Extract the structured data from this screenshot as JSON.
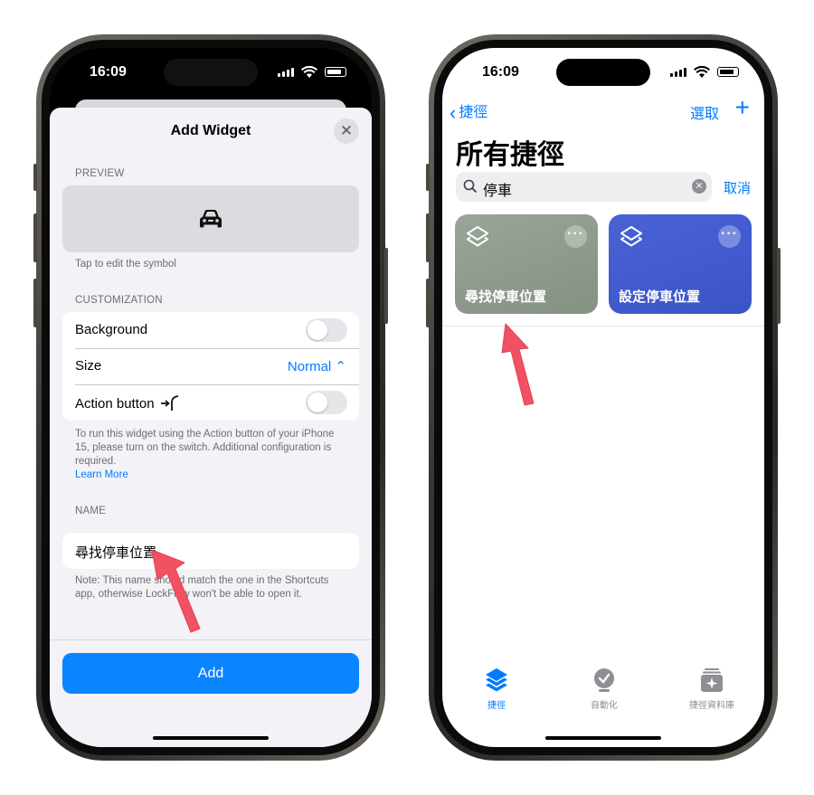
{
  "status": {
    "time": "16:09"
  },
  "left": {
    "sheet_title": "Add Widget",
    "close_glyph": "✕",
    "preview_header": "PREVIEW",
    "preview_icon": "car-icon",
    "preview_footnote": "Tap to edit the symbol",
    "customization_header": "CUSTOMIZATION",
    "background_label": "Background",
    "background_on": false,
    "size_label": "Size",
    "size_value": "Normal ⌃",
    "action_label": "Action button",
    "action_on": false,
    "action_note_1": "To run this widget using the Action button of your iPhone 15, please turn on the switch. Additional configuration is required.",
    "learn_more": "Learn More",
    "name_header": "NAME",
    "name_value": "尋找停車位置",
    "name_note": "Note: This name should match the one in the Shortcuts app, otherwise LockFlow won't be able to open it.",
    "add_label": "Add",
    "accent": "#0a84ff"
  },
  "right": {
    "back_label": "捷徑",
    "select_label": "選取",
    "plus_label": "+",
    "title": "所有捷徑",
    "search_value": "停車",
    "cancel_label": "取消",
    "tiles": [
      {
        "name": "尋找停車位置",
        "color": "#8f9c8e"
      },
      {
        "name": "設定停車位置",
        "color": "#4159cf"
      }
    ],
    "tabs": [
      {
        "label": "捷徑",
        "icon": "shortcuts-stack-icon",
        "active": true
      },
      {
        "label": "自動化",
        "icon": "automation-clock-icon",
        "active": false
      },
      {
        "label": "捷徑資料庫",
        "icon": "gallery-icon",
        "active": false
      }
    ]
  },
  "colors": {
    "arrow": "#f25063",
    "link": "#007aff"
  }
}
